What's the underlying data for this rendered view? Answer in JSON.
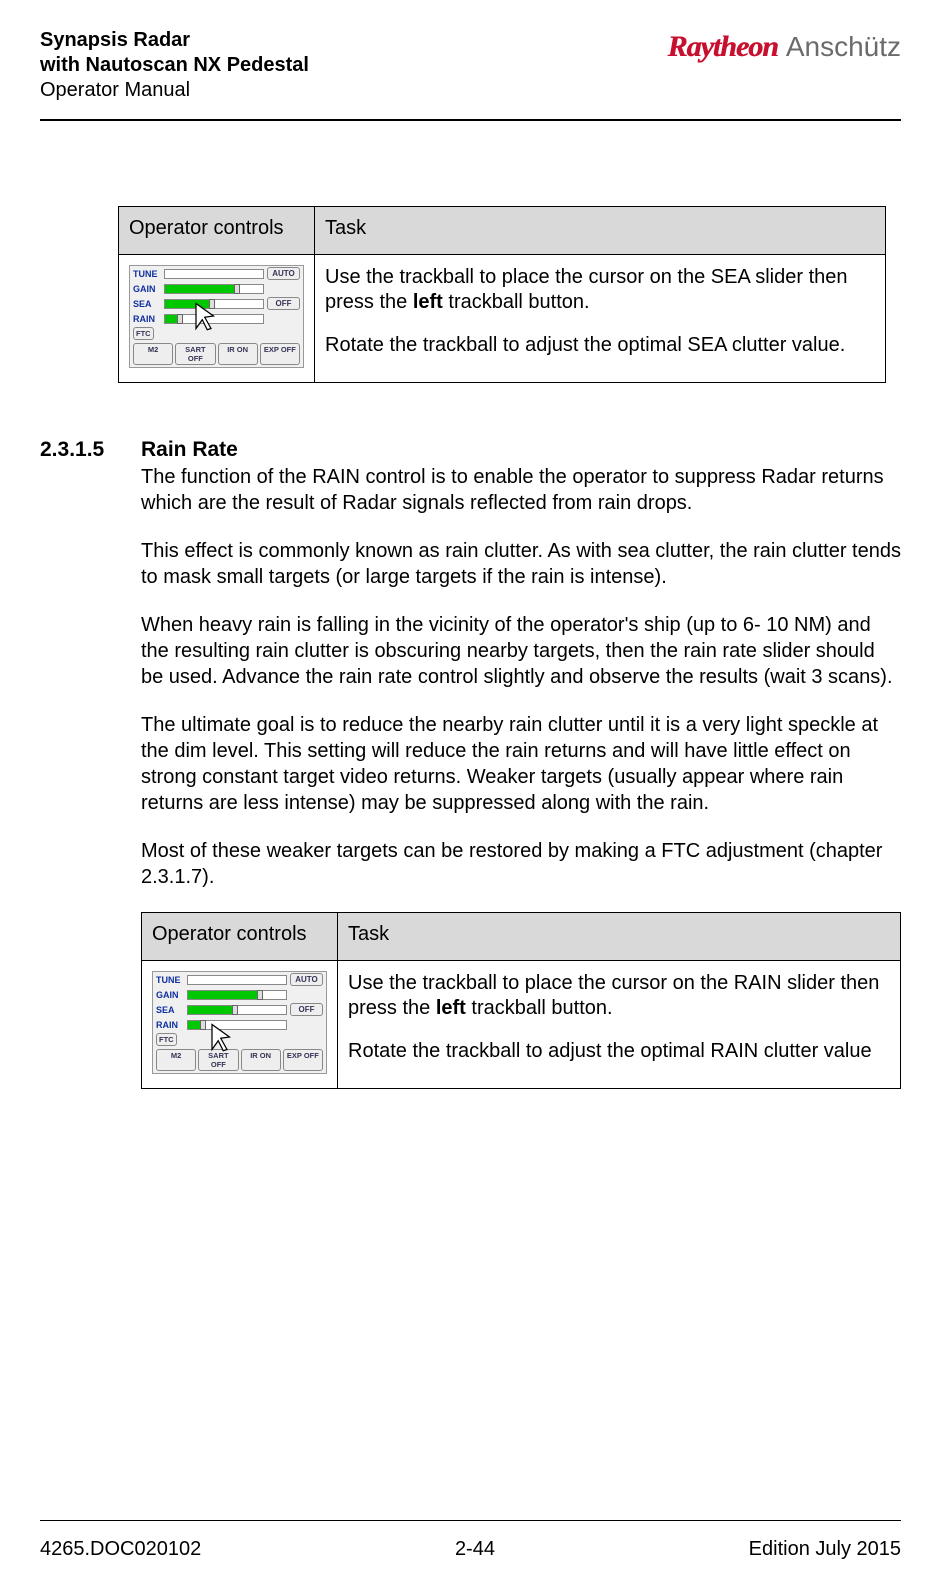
{
  "header": {
    "title_line1": "Synapsis Radar",
    "title_line2": "with Nautoscan NX Pedestal",
    "subtitle": "Operator Manual",
    "logo_primary": "Raytheon",
    "logo_secondary": "Anschütz"
  },
  "table1": {
    "col1": "Operator controls",
    "col2": "Task",
    "task_p1_a": "Use the trackball to place the cursor on the SEA slider then press the ",
    "task_p1_bold": "left",
    "task_p1_b": " trackball button.",
    "task_p2": "Rotate the trackball to adjust the optimal SEA clutter value."
  },
  "section": {
    "number": "2.3.1.5",
    "title": "Rain Rate",
    "p1": "The function of the RAIN control is to enable the operator to suppress Radar returns which are the result of Radar signals reflected from rain drops.",
    "p2": "This effect is commonly known as rain clutter. As with sea clutter, the rain clutter tends to mask small targets (or large targets if the rain is intense).",
    "p3": "When heavy rain is falling in the vicinity of the operator's ship (up to 6- 10 NM) and the resulting rain clutter is obscuring nearby targets, then the rain rate slider should be used. Advance the rain rate control slightly and observe the results (wait 3 scans).",
    "p4": "The ultimate goal is to reduce the nearby rain clutter until it is a very light speckle at the dim level. This setting will reduce the rain returns and will have little effect on strong constant target video returns. Weaker targets (usually appear where rain returns are less intense) may be suppressed along with the rain.",
    "p5": "Most of these weaker targets can be restored by making a FTC adjustment (chapter 2.3.1.7)."
  },
  "table2": {
    "col1": "Operator controls",
    "col2": "Task",
    "task_p1_a": "Use the trackball to place the cursor on the RAIN slider then press the ",
    "task_p1_bold": "left",
    "task_p1_b": " trackball button.",
    "task_p2": "Rotate the trackball to adjust the optimal RAIN clutter value"
  },
  "panel": {
    "labels": {
      "tune": "TUNE",
      "gain": "GAIN",
      "sea": "SEA",
      "rain": "RAIN",
      "ftc": "FTC"
    },
    "buttons": {
      "auto": "AUTO",
      "off": "OFF",
      "m2": "M2",
      "sart": "SART OFF",
      "ir": "IR ON",
      "exp": "EXP OFF"
    },
    "gain_fill_pct": 70,
    "sea_fill_pct": 45,
    "rain_fill_pct": 12
  },
  "footer": {
    "left": "4265.DOC020102",
    "center": "2-44",
    "right": "Edition July 2015"
  }
}
